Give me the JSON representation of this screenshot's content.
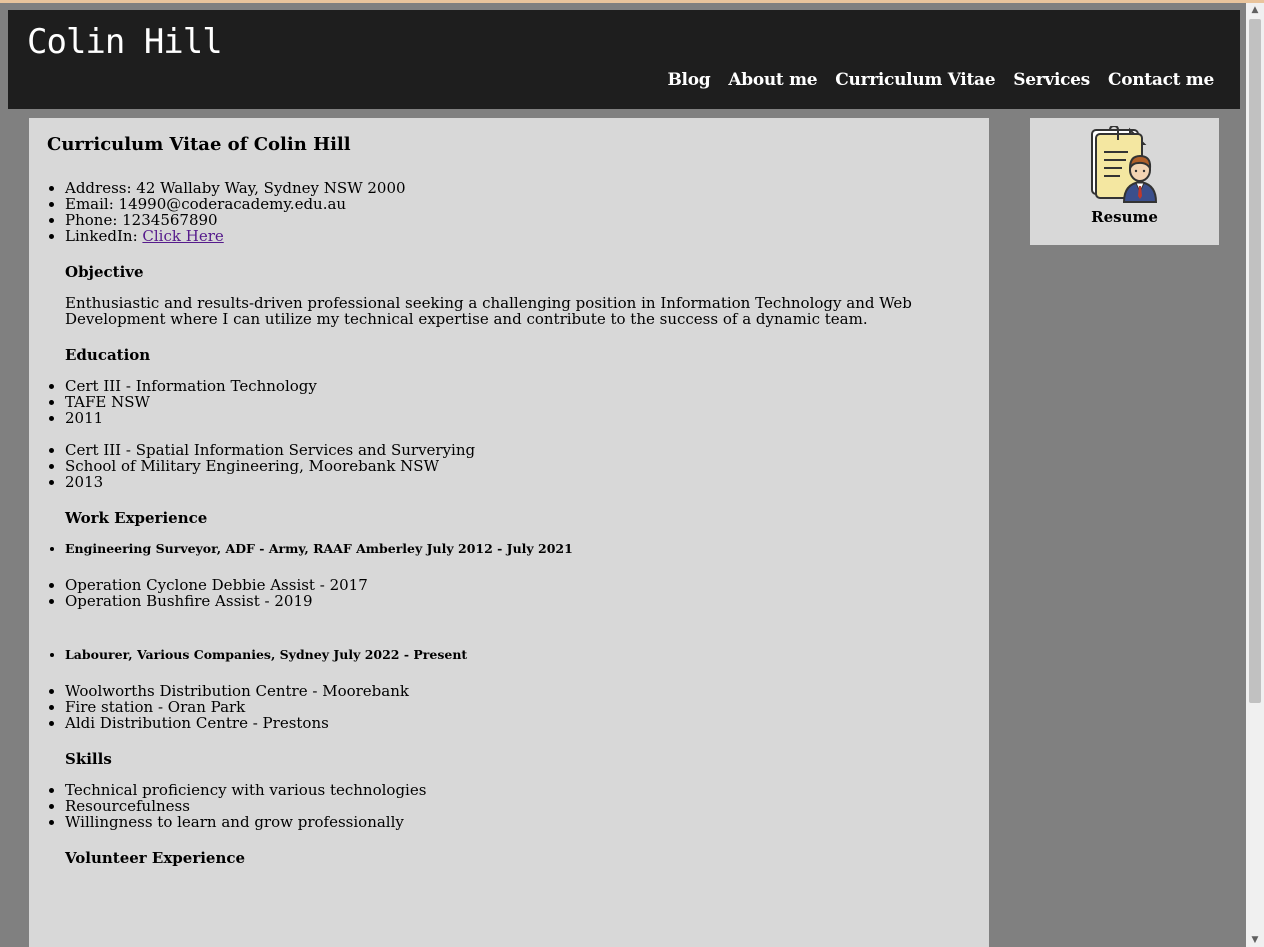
{
  "header": {
    "site_title": "Colin Hill",
    "nav": [
      "Blog",
      "About me",
      "Curriculum Vitae",
      "Services",
      "Contact me"
    ]
  },
  "cv": {
    "title": "Curriculum Vitae of Colin Hill",
    "contact": {
      "address": "Address: 42 Wallaby Way, Sydney NSW 2000",
      "email": "Email: 14990@coderacademy.edu.au",
      "phone": "Phone: 1234567890",
      "linkedin_label": "LinkedIn: ",
      "linkedin_link": "Click Here"
    },
    "objective": {
      "heading": "Objective",
      "text": "Enthusiastic and results-driven professional seeking a challenging position in Information Technology and Web Development where I can utilize my technical expertise and contribute to the success of a dynamic team."
    },
    "education": {
      "heading": "Education",
      "entries": [
        [
          "Cert III - Information Technology",
          "TAFE NSW",
          "2011"
        ],
        [
          "Cert III - Spatial Information Services and Surverying",
          "School of Military Engineering, Moorebank NSW",
          "2013"
        ]
      ]
    },
    "work": {
      "heading": "Work Experience",
      "jobs": [
        {
          "title": "Engineering Surveyor, ADF - Army, RAAF Amberley July 2012 - July 2021",
          "items": [
            "Operation Cyclone Debbie Assist - 2017",
            "Operation Bushfire Assist - 2019"
          ]
        },
        {
          "title": "Labourer, Various Companies, Sydney July 2022 - Present",
          "items": [
            "Woolworths Distribution Centre - Moorebank",
            "Fire station - Oran Park",
            "Aldi Distribution Centre - Prestons"
          ]
        }
      ]
    },
    "skills": {
      "heading": "Skills",
      "items": [
        "Technical proficiency with various technologies",
        "Resourcefulness",
        "Willingness to learn and grow professionally"
      ]
    },
    "volunteer": {
      "heading": "Volunteer Experience"
    }
  },
  "sidebar": {
    "caption": "Resume",
    "icon": "resume-icon"
  },
  "colors": {
    "header_bg": "#1e1e1e",
    "page_bg": "#808080",
    "panel_bg": "#d8d8d8",
    "link": "#551a8b"
  }
}
